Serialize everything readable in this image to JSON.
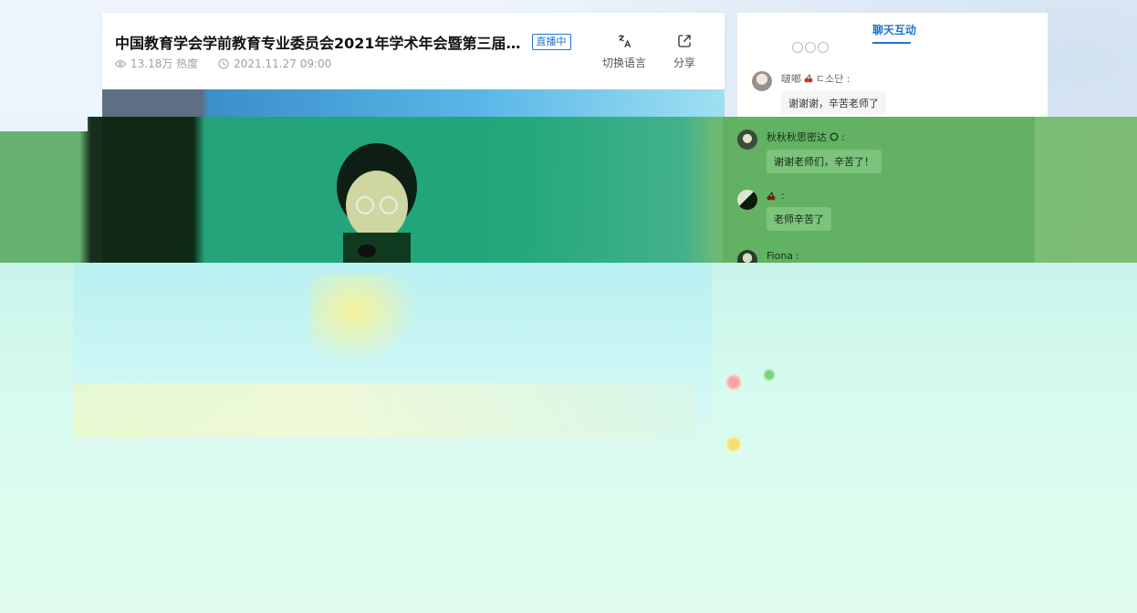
{
  "header": {
    "title": "中国教育学会学前教育专业委员会2021年学术年会暨第三届…",
    "live_badge": "直播中",
    "views": "13.18万 热度",
    "datetime": "2021.11.27 09:00",
    "actions": {
      "switch_language": "切换语言",
      "share": "分享"
    },
    "icons": {
      "views": "eye-icon",
      "time": "clock-icon",
      "language": "translate-icon",
      "share": "share-icon"
    }
  },
  "chat": {
    "active_tab": "聊天互动",
    "accent_color": "#1f74c9",
    "messages": [
      {
        "user": "啵啷",
        "user_suffix": "ㄷ소단 :",
        "text": "谢谢谢，辛苦老师了"
      },
      {
        "user": "秋秋秋思密达",
        "user_suffix": " :",
        "text": "谢谢老师们，辛苦了！"
      },
      {
        "user": "",
        "user_suffix": " :",
        "text": "老师辛苦了"
      },
      {
        "user": "Fiona",
        "user_suffix": " :",
        "text": ""
      }
    ]
  }
}
